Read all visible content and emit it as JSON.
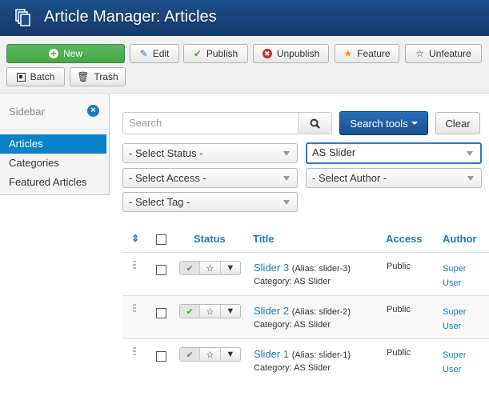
{
  "header": {
    "title": "Article Manager: Articles",
    "icon": "copy-icon"
  },
  "toolbar": {
    "new": "New",
    "edit": "Edit",
    "publish": "Publish",
    "unpublish": "Unpublish",
    "feature": "Feature",
    "unfeature": "Unfeature",
    "batch": "Batch",
    "trash": "Trash"
  },
  "sidebar": {
    "label": "Sidebar",
    "items": [
      {
        "label": "Articles",
        "active": true
      },
      {
        "label": "Categories",
        "active": false
      },
      {
        "label": "Featured Articles",
        "active": false
      }
    ]
  },
  "search": {
    "placeholder": "Search",
    "value": "",
    "tools_label": "Search tools",
    "clear_label": "Clear"
  },
  "filters": {
    "status": "- Select Status -",
    "category": "AS Slider",
    "access": "- Select Access -",
    "author": "- Select Author -",
    "tag": "- Select Tag -"
  },
  "table": {
    "columns": {
      "status": "Status",
      "title": "Title",
      "access": "Access",
      "author": "Author"
    },
    "rows": [
      {
        "title": "Slider 3",
        "alias": "(Alias: slider-3)",
        "category": "Category: AS Slider",
        "access": "Public",
        "author_first": "Super",
        "author_last": "User",
        "published": true,
        "featured": false
      },
      {
        "title": "Slider 2",
        "alias": "(Alias: slider-2)",
        "category": "Category: AS Slider",
        "access": "Public",
        "author_first": "Super",
        "author_last": "User",
        "published": true,
        "featured": false
      },
      {
        "title": "Slider 1",
        "alias": "(Alias: slider-1)",
        "category": "Category: AS Slider",
        "access": "Public",
        "author_first": "Super",
        "author_last": "User",
        "published": true,
        "featured": false
      }
    ]
  },
  "colors": {
    "header": "#1a4f8a",
    "accent": "#1a7cc4",
    "new_button": "#46a546",
    "active_sidebar": "#0a82c8"
  }
}
